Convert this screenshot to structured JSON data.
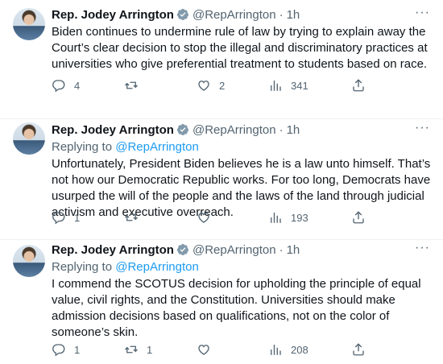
{
  "tweets": [
    {
      "name": "Rep. Jodey Arrington",
      "handle": "@RepArrington",
      "separator": "·",
      "time": "1h",
      "more": "···",
      "replying_prefix": "",
      "replying_handle": "",
      "text": "Biden continues to undermine rule of law by trying to explain away the Court’s clear decision to stop the illegal and discriminatory practices at universities who give preferential treatment to students based on race.",
      "replies": "4",
      "retweets": "",
      "likes": "2",
      "views": "341"
    },
    {
      "name": "Rep. Jodey Arrington",
      "handle": "@RepArrington",
      "separator": "·",
      "time": "1h",
      "more": "···",
      "replying_prefix": "Replying to ",
      "replying_handle": "@RepArrington",
      "text": "Unfortunately, President Biden believes he is a law unto himself. That’s not how our Democratic Republic works. For too long, Democrats have usurped the will of the people and the laws of the land through judicial activism and executive overreach.",
      "replies": "1",
      "retweets": "",
      "likes": "",
      "views": "193"
    },
    {
      "name": "Rep. Jodey Arrington",
      "handle": "@RepArrington",
      "separator": "·",
      "time": "1h",
      "more": "···",
      "replying_prefix": "Replying to ",
      "replying_handle": "@RepArrington",
      "text": "I commend the SCOTUS decision for upholding the principle of equal value, civil rights, and the Constitution. Universities should make admission decisions based on qualifications, not on the color of someone’s skin.",
      "replies": "1",
      "retweets": "1",
      "likes": "",
      "views": "208"
    }
  ],
  "icons": {
    "verified": "verified-badge-icon",
    "reply": "reply-icon",
    "retweet": "retweet-icon",
    "like": "heart-icon",
    "views": "views-icon",
    "share": "share-icon",
    "more": "more-icon"
  },
  "colors": {
    "text": "#0f1419",
    "secondary": "#536471",
    "link": "#1d9bf0",
    "verified": "#829aab",
    "divider": "#eff3f4"
  }
}
